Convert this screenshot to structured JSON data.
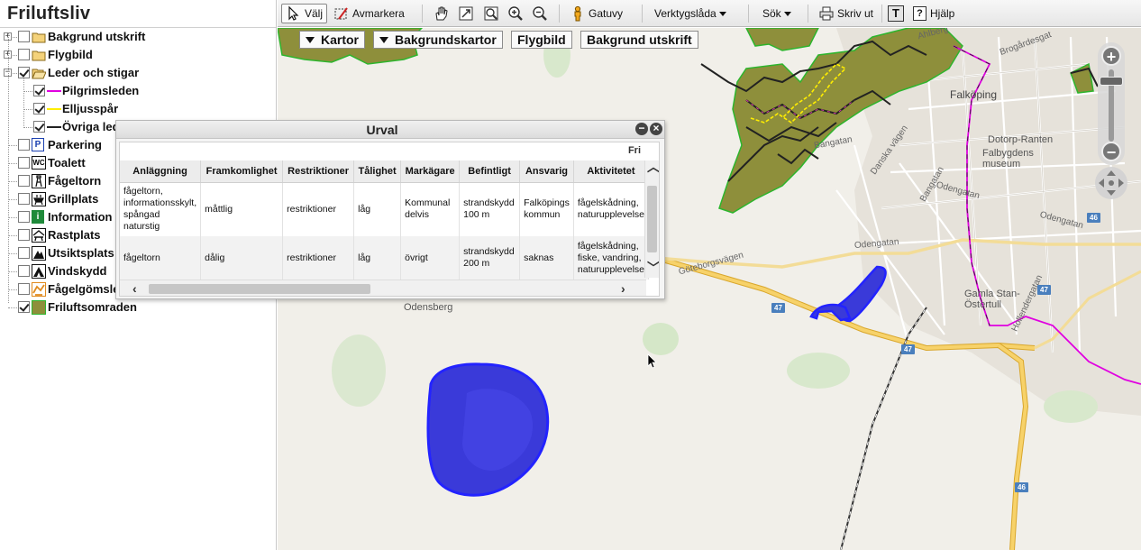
{
  "app": {
    "title": "Friluftsliv"
  },
  "layers": [
    {
      "label": "Bakgrund utskrift",
      "checked": false,
      "icon": "folder-icon"
    },
    {
      "label": "Flygbild",
      "checked": false,
      "icon": "folder-icon"
    },
    {
      "label": "Leder och stigar",
      "checked": true,
      "icon": "folder-open-icon"
    },
    {
      "label": "Pilgrimsleden",
      "checked": true,
      "icon": "line-legend-icon",
      "color": "#e000e0"
    },
    {
      "label": "Elljusspår",
      "checked": true,
      "icon": "line-legend-icon",
      "color": "#ffee00"
    },
    {
      "label": "Övriga leder och stigar",
      "checked": true,
      "icon": "line-legend-icon",
      "color": "#222222"
    },
    {
      "label": "Parkering",
      "checked": false,
      "icon": "parking-icon",
      "symbol": "P"
    },
    {
      "label": "Toalett",
      "checked": false,
      "icon": "toilet-icon",
      "symbol": "WC"
    },
    {
      "label": "Fågeltorn",
      "checked": false,
      "icon": "bird-tower-icon"
    },
    {
      "label": "Grillplats",
      "checked": false,
      "icon": "grill-icon"
    },
    {
      "label": "Information",
      "checked": false,
      "icon": "info-icon",
      "symbol": "i"
    },
    {
      "label": "Rastplats",
      "checked": false,
      "icon": "rest-area-icon"
    },
    {
      "label": "Utsiktsplats",
      "checked": false,
      "icon": "viewpoint-icon"
    },
    {
      "label": "Vindskydd",
      "checked": false,
      "icon": "shelter-icon"
    },
    {
      "label": "Fågelgömsle",
      "checked": false,
      "icon": "bird-hide-icon"
    },
    {
      "label": "Friluftsomraden",
      "checked": true,
      "icon": "area-legend-icon",
      "color": "#8e8f3b"
    }
  ],
  "toolbar": {
    "select": "Välj",
    "deselect": "Avmarkera",
    "streetview": "Gatuvy",
    "toolbox": "Verktygslåda",
    "search": "Sök",
    "print": "Skriv ut",
    "text_tool": "T",
    "help": "Hjälp",
    "help_glyph": "?"
  },
  "base_switcher": {
    "maps": "Kartor",
    "base_maps": "Bakgrundskartor",
    "aerial": "Flygbild",
    "print_bg": "Bakgrund utskrift"
  },
  "map_labels": {
    "falkoping": "Falköping",
    "dotorp": "Dotorp-Ranten",
    "museum": "Falbygdens museum",
    "gamla": "Gamla Stan-Östertull",
    "odensberg": "Odensberg",
    "danska": "Danska vägen",
    "bangatan1": "Bangatan",
    "bangatan2": "Bangatan",
    "odengatan1": "Odengatan",
    "odengatan2": "Odengatan",
    "odengatan3": "Odengatan",
    "goteborgsvagen": "Göteborgsvägen",
    "brogardesgatan": "Brogårdesgat",
    "hollendergatan": "Hollendergatan",
    "ahlbergs": "Ahlberg",
    "r46a": "46",
    "r46b": "46",
    "r47a": "47",
    "r47b": "47",
    "r47c": "47"
  },
  "zoom": {
    "plus": "+",
    "minus": "−",
    "level_fraction": 0.1
  },
  "urval": {
    "title": "Urval",
    "group_label": "Fri",
    "columns": [
      "Anläggning",
      "Framkomlighet",
      "Restriktioner",
      "Tålighet",
      "Markägare",
      "Befintligt",
      "Ansvarig",
      "Aktivitetet"
    ],
    "rows": [
      [
        "fågeltorn, informationsskylt, spångad naturstig",
        "måttlig",
        "restriktioner",
        "låg",
        "Kommunal delvis",
        "strandskydd 100 m",
        "Falköpings kommun",
        "fågelskådning, naturupplevelse"
      ],
      [
        "fågeltorn",
        "dålig",
        "restriktioner",
        "låg",
        "övrigt",
        "strandskydd 200 m",
        "saknas",
        "fågelskådning, fiske, vandring, naturupplevelse"
      ]
    ],
    "minimize": "−",
    "close": "×"
  },
  "colors": {
    "pilgrim": "#e000e0",
    "elljus": "#ffee00",
    "trail": "#222222",
    "area_fill": "#8e8f3b",
    "area_stroke": "#2db52d",
    "lake_fill": "#3a3ad9",
    "road": "#f7c948",
    "map_bg": "#f1efe9"
  }
}
